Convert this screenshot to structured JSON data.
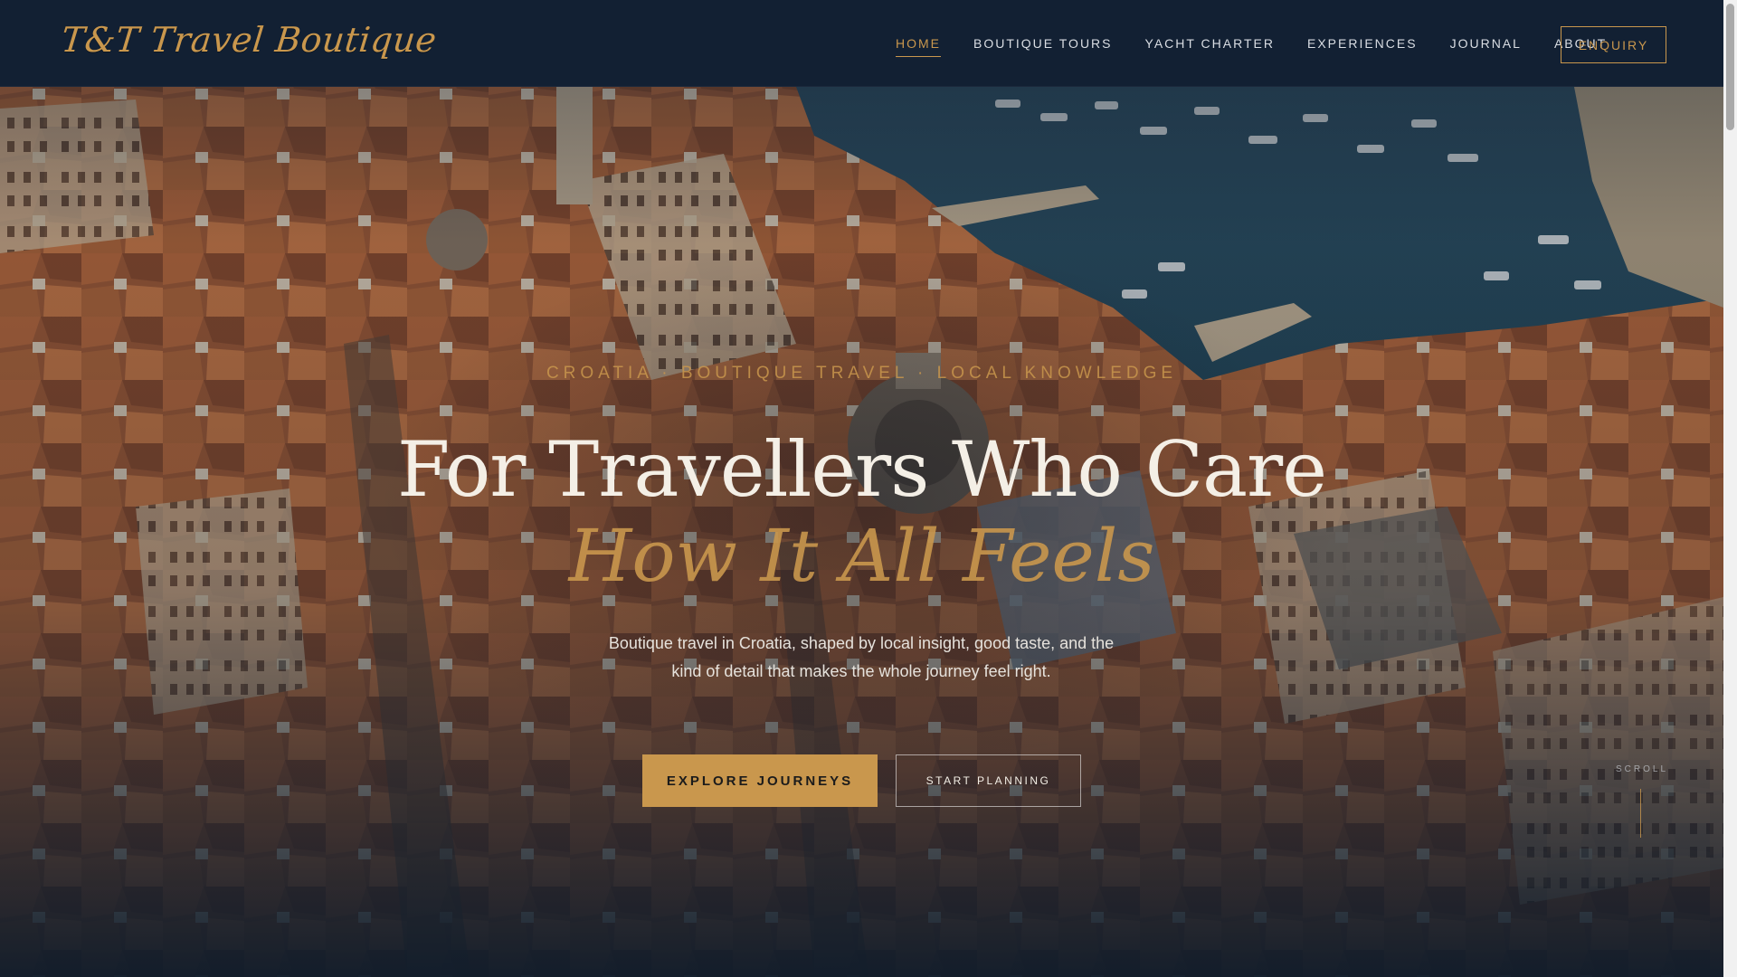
{
  "brand": {
    "logo_text": "T&T Travel Boutique"
  },
  "nav": {
    "items": [
      {
        "label": "HOME",
        "active": true
      },
      {
        "label": "BOUTIQUE TOURS",
        "active": false
      },
      {
        "label": "YACHT CHARTER",
        "active": false
      },
      {
        "label": "EXPERIENCES",
        "active": false
      },
      {
        "label": "JOURNAL",
        "active": false
      },
      {
        "label": "ABOUT",
        "active": false
      }
    ],
    "enquiry_label": "ENQUIRY"
  },
  "hero": {
    "kicker": "CROATIA · BOUTIQUE TRAVEL · LOCAL KNOWLEDGE",
    "headline": "For Travellers Who Care",
    "subhead": "How It All Feels",
    "lede": "Boutique travel in Croatia, shaped by local insight, good taste, and the kind of detail that makes the whole journey feel right.",
    "primary_cta": "EXPLORE JOURNEYS",
    "secondary_cta": "START PLANNING",
    "scroll_label": "SCROLL"
  },
  "colors": {
    "accent": "#c9974d",
    "navy": "#122033",
    "text_light": "#f4efe6"
  }
}
